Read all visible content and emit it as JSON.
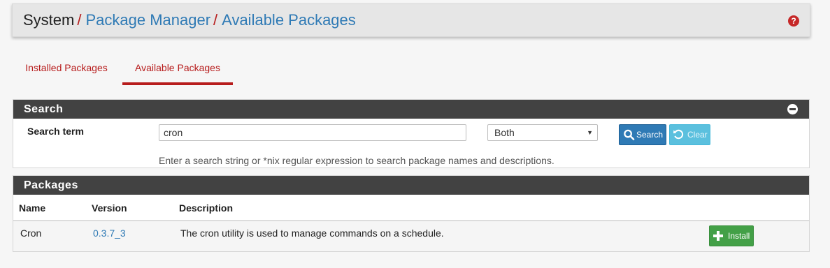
{
  "breadcrumb": {
    "items": [
      "System",
      "Package Manager",
      "Available Packages"
    ],
    "separator": "/",
    "help_icon": "question-circle-icon"
  },
  "tabs": [
    {
      "label": "Installed Packages",
      "active": false
    },
    {
      "label": "Available Packages",
      "active": true
    }
  ],
  "search": {
    "panel_title": "Search",
    "collapse_icon": "minus-circle-icon",
    "term_label": "Search term",
    "term_value": "cron",
    "where_selected": "Both",
    "search_button": "Search",
    "search_icon": "search-icon",
    "clear_button": "Clear",
    "clear_icon": "undo-icon",
    "hint": "Enter a search string or *nix regular expression to search package names and descriptions."
  },
  "packages": {
    "panel_title": "Packages",
    "columns": [
      "Name",
      "Version",
      "Description"
    ],
    "rows": [
      {
        "name": "Cron",
        "version": "0.3.7_3",
        "description": "The cron utility is used to manage commands on a schedule.",
        "action": "Install",
        "action_icon": "plus-icon"
      }
    ]
  },
  "colors": {
    "accent_red": "#b71c1c",
    "link_blue": "#2f7ab5",
    "panel_header": "#424242",
    "install_green": "#43a047",
    "clear_cyan": "#5bc0de"
  }
}
